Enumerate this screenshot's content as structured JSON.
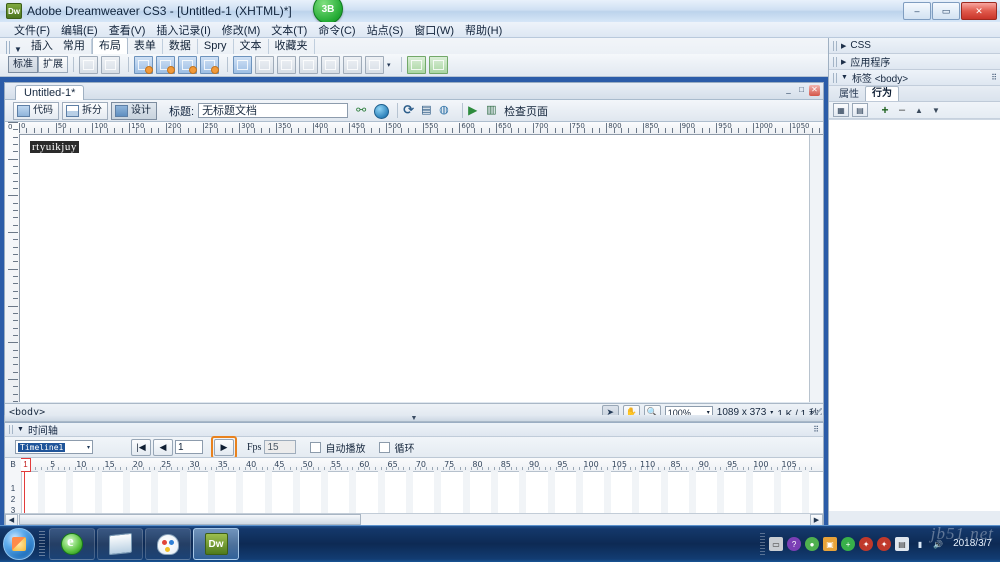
{
  "window": {
    "title": "Adobe Dreamweaver CS3 - [Untitled-1 (XHTML)*]",
    "app_icon": "Dw",
    "badge": "3B",
    "minimize": "–",
    "maximize": "▭",
    "close": "✕"
  },
  "menu": {
    "items": [
      {
        "label": "文件(F)"
      },
      {
        "label": "编辑(E)"
      },
      {
        "label": "查看(V)"
      },
      {
        "label": "插入记录(I)"
      },
      {
        "label": "修改(M)"
      },
      {
        "label": "文本(T)"
      },
      {
        "label": "命令(C)"
      },
      {
        "label": "站点(S)"
      },
      {
        "label": "窗口(W)"
      },
      {
        "label": "帮助(H)"
      }
    ]
  },
  "insert_bar": {
    "collapse_arrow": "▼",
    "tabs": [
      {
        "label": "插入",
        "active": false
      },
      {
        "label": "常用",
        "active": false
      },
      {
        "label": "布局",
        "active": true
      },
      {
        "label": "表单",
        "active": false
      },
      {
        "label": "数据",
        "active": false
      },
      {
        "label": "Spry",
        "active": false
      },
      {
        "label": "文本",
        "active": false
      },
      {
        "label": "收藏夹",
        "active": false
      }
    ],
    "mode_buttons": [
      {
        "label": "标准",
        "selected": true
      },
      {
        "label": "扩展",
        "selected": false
      }
    ],
    "tool_icons": [
      "draw-div-tag-icon",
      "insert-div-icon",
      "spry-menu-bar-icon",
      "spry-tabbed-panels-icon",
      "spry-accordion-icon",
      "spry-collapsible-panel-icon",
      "insert-table-icon",
      "draw-layout-table-icon",
      "draw-layout-cell-icon",
      "insert-column-left-icon",
      "insert-column-right-icon",
      "insert-frame-icon",
      "insert-frameset-icon",
      "iframe-icon",
      "noframes-icon"
    ]
  },
  "document_window": {
    "tab_label": "Untitled-1*",
    "window_buttons": {
      "minimize": "_",
      "restore": "□",
      "close": "✕"
    },
    "toolbar": {
      "view_buttons": [
        {
          "label": "代码",
          "selected": false
        },
        {
          "label": "拆分",
          "selected": false
        },
        {
          "label": "设计",
          "selected": true
        }
      ],
      "title_label": "标题:",
      "title_value": "无标题文档",
      "check_page_label": "检查页面",
      "icons": [
        "file-management-icon",
        "preview-in-browser-icon",
        "refresh-icon",
        "view-options-icon",
        "visual-aids-icon",
        "validate-markup-icon",
        "check-page-icon"
      ]
    },
    "ruler": {
      "labels": [
        0,
        50,
        100,
        150,
        200,
        250,
        300,
        350,
        400,
        450,
        500,
        550,
        600,
        650,
        700,
        750,
        800,
        850,
        900,
        950,
        1000,
        1050
      ],
      "origin_label": "0",
      "unit_step": 50
    },
    "canvas": {
      "selected_text": "rtyuikjuy"
    },
    "status_bar": {
      "tag_selector": "<body>",
      "zoom_value": "100%",
      "dimensions": "1089 x 373",
      "size_time": "1 K / 1 秒",
      "tools": [
        "select-tool-icon",
        "hand-tool-icon",
        "zoom-tool-icon"
      ]
    }
  },
  "timeline_panel": {
    "title": "时间轴",
    "collapse_arrow": "▼",
    "timeline_name": "Timeline1",
    "controls": {
      "rewind_label": "|◀",
      "back_label": "◀",
      "frame_value": "1",
      "forward_label": "▶",
      "forward_highlighted": true,
      "fps_label": "Fps",
      "fps_value": "15",
      "autoplay_label": "自动播放",
      "autoplay_checked": false,
      "loop_label": "循环",
      "loop_checked": false
    },
    "behavior_row_label": "B",
    "channel_rows": [
      "1",
      "2",
      "3"
    ],
    "frame_numbers": [
      1,
      5,
      10,
      15,
      20,
      25,
      30,
      35,
      40,
      45,
      50,
      55,
      60,
      65,
      70,
      75,
      80,
      85,
      90,
      95,
      100,
      105,
      110,
      85,
      90,
      95,
      100,
      105
    ],
    "playhead_frame": "1"
  },
  "right_panels": {
    "sections": [
      {
        "label": "CSS",
        "expanded": false,
        "arrow": "▶"
      },
      {
        "label": "应用程序",
        "expanded": false,
        "arrow": "▶"
      },
      {
        "label": "标签 <body>",
        "expanded": true,
        "arrow": "▼"
      }
    ],
    "tabs": [
      {
        "label": "属性",
        "active": false
      },
      {
        "label": "行为",
        "active": true
      }
    ],
    "toolbar_icons": [
      "show-set-events-icon",
      "show-all-events-icon",
      "add-behavior-icon",
      "remove-behavior-icon",
      "move-up-icon",
      "move-down-icon"
    ],
    "add_label": "+",
    "remove_label": "–",
    "up_label": "▲",
    "down_label": "▼",
    "options_icon": "panel-options-icon"
  },
  "taskbar": {
    "start_label": "start-orb-icon",
    "items": [
      {
        "name": "internet-explorer",
        "label": "e",
        "active": false
      },
      {
        "name": "windows-explorer",
        "label": "",
        "active": false
      },
      {
        "name": "paint",
        "label": "",
        "active": false
      },
      {
        "name": "dreamweaver",
        "label": "Dw",
        "active": true
      }
    ],
    "tray_icons": [
      "safe-remove-icon",
      "help-icon",
      "shield-icon",
      "update-icon",
      "antivirus-icon",
      "antivirus2-icon",
      "notepad-icon",
      "network-icon",
      "volume-icon"
    ],
    "clock": "2018/3/7",
    "watermark": "jb51.net"
  },
  "colors": {
    "accent_orange": "#e8821e",
    "title_blue": "#bcd3ec",
    "taskbar_blue": "#0d2a54",
    "selection_dark": "#2a2a2a",
    "playhead_red": "#e23b3b"
  }
}
